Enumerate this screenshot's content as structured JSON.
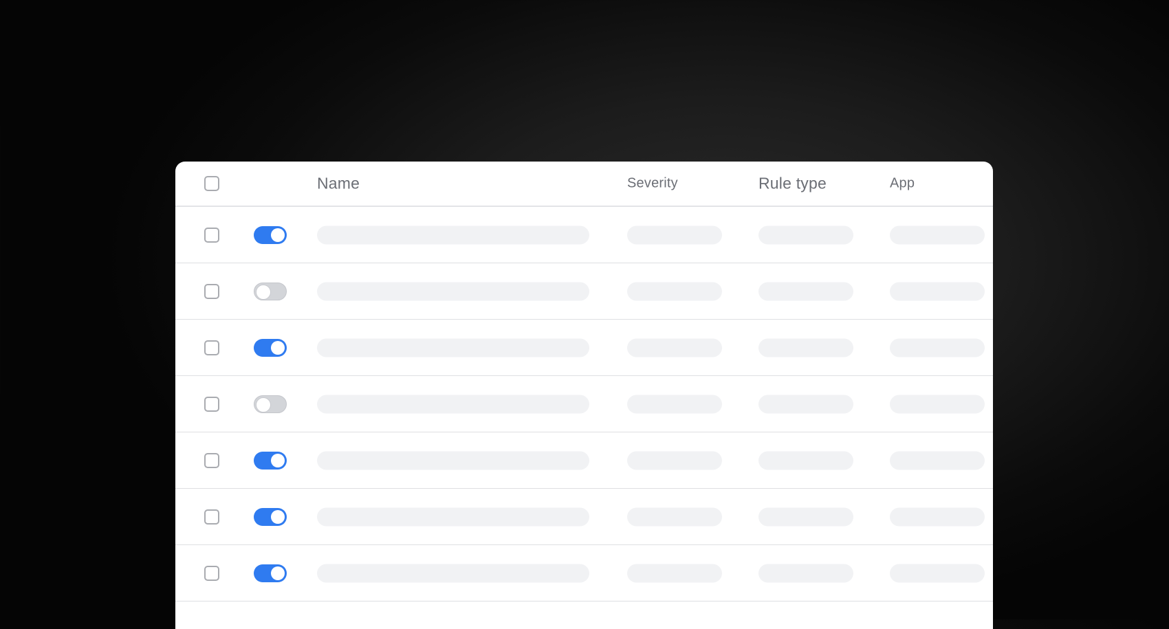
{
  "table": {
    "columns": {
      "select_all": "",
      "enabled": "",
      "name": "Name",
      "severity": "Severity",
      "rule_type": "Rule type",
      "app": "App"
    },
    "rows": [
      {
        "enabled": true
      },
      {
        "enabled": false
      },
      {
        "enabled": true
      },
      {
        "enabled": false
      },
      {
        "enabled": true
      },
      {
        "enabled": true
      },
      {
        "enabled": true
      }
    ]
  },
  "colors": {
    "toggle_on": "#2f7bf0",
    "toggle_off": "#d3d5d9",
    "placeholder": "#f1f2f4"
  },
  "icons": {
    "checkbox": "checkbox-icon",
    "toggle": "toggle-switch-icon"
  }
}
